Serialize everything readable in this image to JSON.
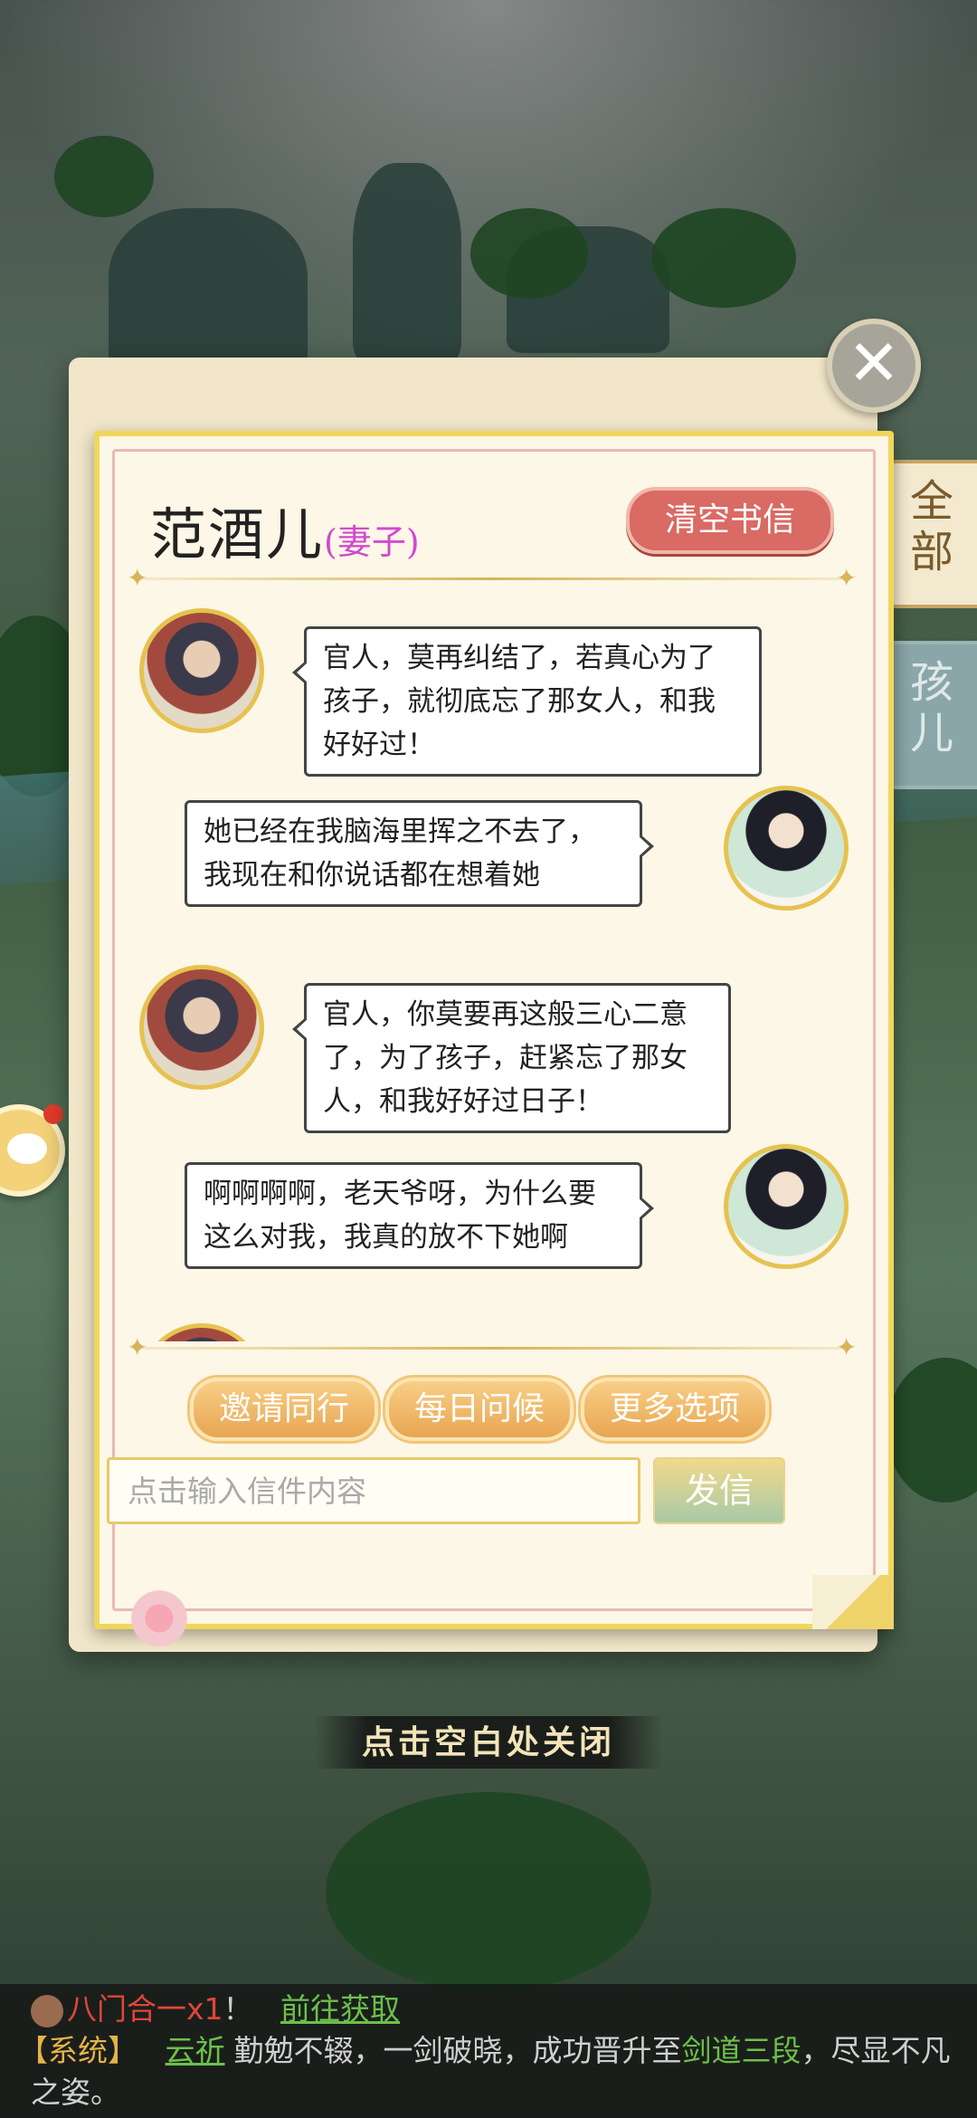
{
  "header": {
    "character_name": "范酒儿",
    "relation": "(妻子)",
    "clear_button": "清空书信"
  },
  "side_tabs": [
    {
      "label": "全部",
      "active": true
    },
    {
      "label": "孩儿",
      "active": false
    }
  ],
  "messages": [
    {
      "sender": "wife",
      "text": "官人，莫再纠结了，若真心为了孩子，就彻底忘了那女人，和我好好过！"
    },
    {
      "sender": "husband",
      "text": "她已经在我脑海里挥之不去了，我现在和你说话都在想着她"
    },
    {
      "sender": "wife",
      "text": "官人，你莫要再这般三心二意了，为了孩子，赶紧忘了那女人，和我好好过日子！"
    },
    {
      "sender": "husband",
      "text": "啊啊啊啊，老天爷呀，为什么要这么对我，我真的放不下她啊"
    }
  ],
  "actions": {
    "invite": "邀请同行",
    "daily_greeting": "每日问候",
    "more_options": "更多选项"
  },
  "compose": {
    "placeholder": "点击输入信件内容",
    "send": "发信"
  },
  "close_hint": "点击空白处关闭",
  "broadcast": {
    "line1_item": "八门合一x1",
    "line1_excl": "！",
    "line1_link": "前往获取",
    "line2_tag": "【系统】",
    "line2_player": "云祈",
    "line2_text_a": "勤勉不辍，一剑破晓，成功晋升至",
    "line2_rank": "剑道三段",
    "line2_text_b": "，尽显不凡",
    "line3_text": "之姿。"
  },
  "colors": {
    "relation": "#d04ad0",
    "clear_button": "#d96a64",
    "action_button": "#e8a552",
    "panel_border": "#f0d75a"
  }
}
